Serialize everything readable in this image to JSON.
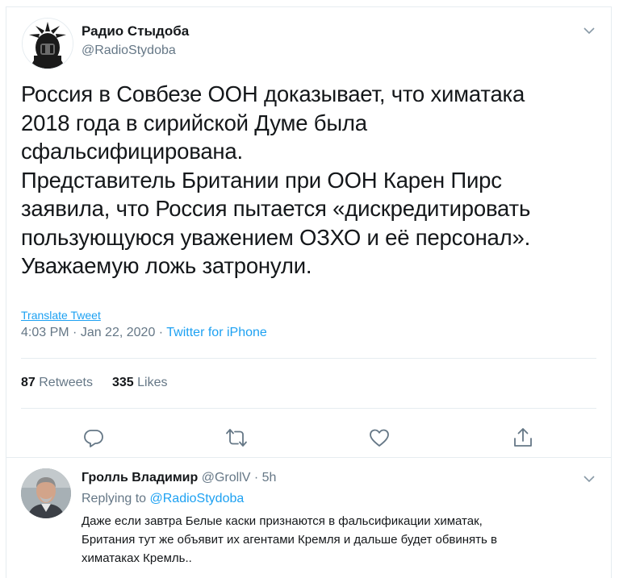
{
  "tweet": {
    "author_name": "Радио Стыдоба",
    "author_handle": "@RadioStydoba",
    "text": "Россия в Совбезе ООН доказывает, что химатака\n2018 года в сирийской Думе была\nсфальсифицирована.\nПредставитель Британии при ООН Карен Пирс\nзаявила, что Россия пытается «дискредитировать\nпользующуюся уважением ОЗХО и её персонал».\nУважаемую ложь затронули.",
    "translate_label": "Translate Tweet",
    "time": "4:03 PM",
    "date": "Jan 22, 2020",
    "source": "Twitter for iPhone",
    "separator": " · ",
    "retweets_count": "87",
    "retweets_label": "Retweets",
    "likes_count": "335",
    "likes_label": "Likes"
  },
  "reply": {
    "author_name": "Гролль Владимир",
    "author_handle": "@GrollV",
    "age": "5h",
    "separator": " · ",
    "replying_prefix": "Replying to",
    "replying_to": "@RadioStydoba",
    "text": "Даже если завтра Белые каски признаются в фальсификации химатак,\nБритания тут же объявит их агентами Кремля и дальше будет обвинять в\nхиматаках Кремль.."
  },
  "icons": {
    "reply": "reply-icon",
    "retweet": "retweet-icon",
    "like": "heart-icon",
    "share": "share-icon",
    "more": "chevron-down-icon"
  },
  "colors": {
    "accent": "#1da1f2",
    "muted": "#657786",
    "text": "#14171a",
    "border": "#e6ecf0"
  }
}
